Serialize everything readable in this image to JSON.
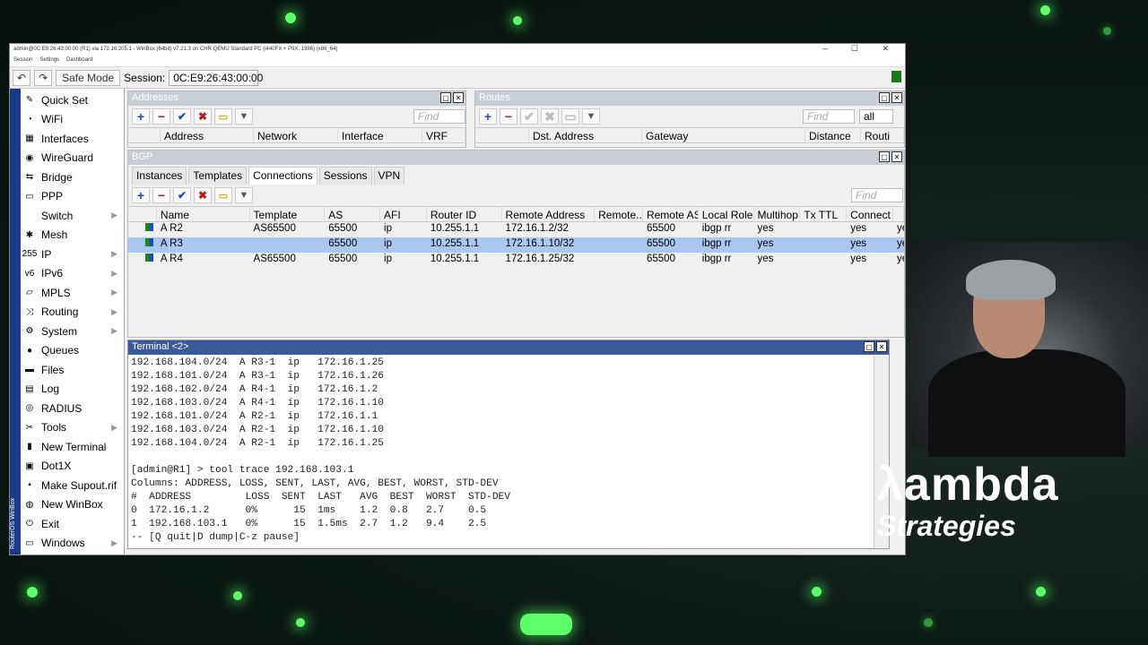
{
  "window": {
    "title": "admin@0C:E9:26:43:00:00 (R1) via 172.16.205.1 - WinBox (64bit) v7.21.3 on CHR QEMU Standard PC (i440FX + PIIX, 1996) (x86_64)",
    "controls": "– ☐ ✕"
  },
  "menu": [
    "Session",
    "Settings",
    "Dashboard"
  ],
  "toolbar": {
    "undo": "↶",
    "redo": "↷",
    "safe_mode": "Safe Mode",
    "session_label": "Session:",
    "session_value": "0C:E9:26:43:00:00"
  },
  "sidebar": {
    "strip": "RouterOS WinBox",
    "items": [
      {
        "label": "Quick Set",
        "icon": "✎",
        "icon_name": "wand-icon"
      },
      {
        "label": "WiFi",
        "icon": "◔",
        "icon_name": "wifi-icon"
      },
      {
        "label": "Interfaces",
        "icon": "▦",
        "icon_name": "interfaces-icon"
      },
      {
        "label": "WireGuard",
        "icon": "◉",
        "icon_name": "wireguard-icon"
      },
      {
        "label": "Bridge",
        "icon": "⇆",
        "icon_name": "bridge-icon"
      },
      {
        "label": "PPP",
        "icon": "▭",
        "icon_name": "ppp-icon"
      },
      {
        "label": "Switch",
        "icon": "",
        "icon_name": "switch-icon",
        "arrow": "▶"
      },
      {
        "label": "Mesh",
        "icon": "✱",
        "icon_name": "mesh-icon"
      },
      {
        "label": "IP",
        "icon": "255",
        "icon_name": "ip-icon",
        "arrow": "▶"
      },
      {
        "label": "IPv6",
        "icon": "v6",
        "icon_name": "ipv6-icon",
        "arrow": "▶"
      },
      {
        "label": "MPLS",
        "icon": "▱",
        "icon_name": "mpls-icon",
        "arrow": "▶"
      },
      {
        "label": "Routing",
        "icon": "⤨",
        "icon_name": "routing-icon",
        "arrow": "▶"
      },
      {
        "label": "System",
        "icon": "⚙",
        "icon_name": "system-icon",
        "arrow": "▶"
      },
      {
        "label": "Queues",
        "icon": "●",
        "icon_name": "queues-icon"
      },
      {
        "label": "Files",
        "icon": "▬",
        "icon_name": "files-icon"
      },
      {
        "label": "Log",
        "icon": "▤",
        "icon_name": "log-icon"
      },
      {
        "label": "RADIUS",
        "icon": "◎",
        "icon_name": "radius-icon"
      },
      {
        "label": "Tools",
        "icon": "✂",
        "icon_name": "tools-icon",
        "arrow": "▶"
      },
      {
        "label": "New Terminal",
        "icon": "▮",
        "icon_name": "terminal-icon"
      },
      {
        "label": "Dot1X",
        "icon": "▣",
        "icon_name": "dot1x-icon"
      },
      {
        "label": "Make Supout.rif",
        "icon": "▪",
        "icon_name": "supout-icon"
      },
      {
        "label": "New WinBox",
        "icon": "◍",
        "icon_name": "winbox-icon"
      },
      {
        "label": "Exit",
        "icon": "⏻",
        "icon_name": "exit-icon"
      },
      {
        "label": "Windows",
        "icon": "▭",
        "icon_name": "windows-icon",
        "arrow": "▶"
      }
    ]
  },
  "addresses": {
    "title": "Addresses",
    "find": "Find",
    "columns": [
      "Address",
      "Network",
      "Interface",
      "VRF"
    ]
  },
  "routes": {
    "title": "Routes",
    "find": "Find",
    "filter": "all",
    "columns": [
      "Dst. Address",
      "Gateway",
      "Distance",
      "Routi"
    ]
  },
  "bgp": {
    "title": "BGP",
    "tabs": [
      "Instances",
      "Templates",
      "Connections",
      "Sessions",
      "VPN"
    ],
    "active_tab": "Connections",
    "find": "Find",
    "columns": [
      "Name",
      "Template",
      "AS",
      "AFI",
      "Router ID",
      "Remote Address",
      "Remote...",
      "Remote AS",
      "Local Role",
      "Multihop",
      "Tx TTL",
      "Connect",
      ""
    ],
    "rows": [
      [
        "A R2",
        "AS65500",
        "65500",
        "ip",
        "10.255.1.1",
        "172.16.1.2/32",
        "",
        "65500",
        "ibgp rr",
        "yes",
        "",
        "yes",
        "ye"
      ],
      [
        "A R3",
        "",
        "65500",
        "ip",
        "10.255.1.1",
        "172.16.1.10/32",
        "",
        "65500",
        "ibgp rr",
        "yes",
        "",
        "yes",
        "ye"
      ],
      [
        "A R4",
        "AS65500",
        "65500",
        "ip",
        "10.255.1.1",
        "172.16.1.25/32",
        "",
        "65500",
        "ibgp rr",
        "yes",
        "",
        "yes",
        "ye"
      ]
    ]
  },
  "terminal": {
    "title": "Terminal <2>",
    "lines": [
      "192.168.104.0/24  A R3-1  ip   172.16.1.25",
      "192.168.101.0/24  A R3-1  ip   172.16.1.26",
      "192.168.102.0/24  A R4-1  ip   172.16.1.2",
      "192.168.103.0/24  A R4-1  ip   172.16.1.10",
      "192.168.101.0/24  A R2-1  ip   172.16.1.1",
      "192.168.103.0/24  A R2-1  ip   172.16.1.10",
      "192.168.104.0/24  A R2-1  ip   172.16.1.25",
      "",
      "[admin@R1] > tool trace 192.168.103.1",
      "Columns: ADDRESS, LOSS, SENT, LAST, AVG, BEST, WORST, STD-DEV",
      "#  ADDRESS         LOSS  SENT  LAST   AVG  BEST  WORST  STD-DEV",
      "0  172.16.1.2      0%      15  1ms    1.2  0.8   2.7    0.5",
      "1  192.168.103.1   0%      15  1.5ms  2.7  1.2   9.4    2.5",
      "-- [Q quit|D dump|C-z pause]"
    ]
  },
  "logo": {
    "line1": "λambda",
    "line2": "Strategies"
  },
  "colors": {
    "accent": "#3a5a9a",
    "selected_row": "#a9c7ef",
    "dots": "#5dff6a"
  }
}
